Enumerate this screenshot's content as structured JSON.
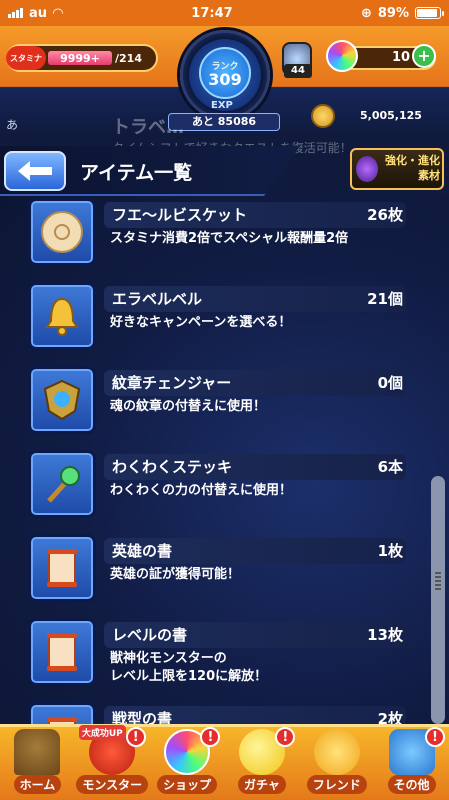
{
  "status_bar": {
    "carrier": "au",
    "time": "17:47",
    "battery": "89%"
  },
  "header": {
    "stamina_label": "スタミナ",
    "stamina_value": "9999+",
    "stamina_max": "/214",
    "rank_label": "ランク",
    "rank_value": "309",
    "exp_label": "EXP",
    "exp_remaining": "あと 85086",
    "cal_count": "44",
    "orb_count": "10",
    "gold": "5,005,125",
    "side_mark": "あ"
  },
  "ghost_row": {
    "title": "トラベ…",
    "desc": "タイムシフトで好きなクエストを復活可能！"
  },
  "title_bar": {
    "title": "アイテム一覧",
    "evolve_label_line1": "強化・進化",
    "evolve_label_line2": "素材"
  },
  "items": [
    {
      "name": "フエ〜ルビスケット",
      "count": "26枚",
      "desc": "スタミナ消費2倍でスペシャル報酬量2倍",
      "icon": "biscuit-icon"
    },
    {
      "name": "エラベルベル",
      "count": "21個",
      "desc": "好きなキャンペーンを選べる！",
      "icon": "bell-icon"
    },
    {
      "name": "紋章チェンジャー",
      "count": "0個",
      "desc": "魂の紋章の付替えに使用！",
      "icon": "emblem-icon"
    },
    {
      "name": "わくわくステッキ",
      "count": "6本",
      "desc": "わくわくの力の付替えに使用！",
      "icon": "wand-icon"
    },
    {
      "name": "英雄の書",
      "count": "1枚",
      "desc": "英雄の証が獲得可能！",
      "icon": "scroll-icon"
    },
    {
      "name": "レベルの書",
      "count": "13枚",
      "desc": "獣神化モンスターの\nレベル上限を120に解放！",
      "icon": "scroll-icon"
    },
    {
      "name": "戦型の書",
      "count": "2枚",
      "desc": "",
      "icon": "scroll-icon"
    }
  ],
  "bottom_nav": [
    {
      "label": "ホーム",
      "icon": "home-icon",
      "badge": "",
      "ribbon": ""
    },
    {
      "label": "モンスター",
      "icon": "monster-icon",
      "badge": "!",
      "ribbon": "大成功UP"
    },
    {
      "label": "ショップ",
      "icon": "orb-icon",
      "badge": "!",
      "ribbon": ""
    },
    {
      "label": "ガチャ",
      "icon": "gacha-icon",
      "badge": "!",
      "ribbon": ""
    },
    {
      "label": "フレンド",
      "icon": "friend-icon",
      "badge": "",
      "ribbon": ""
    },
    {
      "label": "その他",
      "icon": "other-icon",
      "badge": "!",
      "ribbon": ""
    }
  ]
}
